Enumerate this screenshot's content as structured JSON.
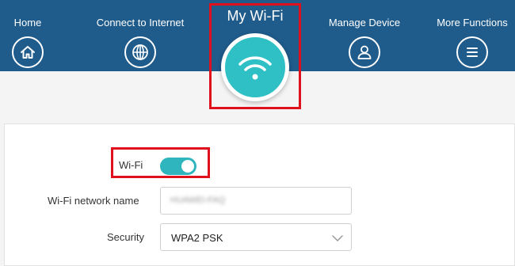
{
  "nav": {
    "items": [
      {
        "label": "Home",
        "icon": "home-icon"
      },
      {
        "label": "Connect to Internet",
        "icon": "globe-icon"
      },
      {
        "label": "Manage Device",
        "icon": "user-icon"
      },
      {
        "label": "More Functions",
        "icon": "menu-icon"
      }
    ],
    "active": {
      "label": "My Wi-Fi",
      "icon": "wifi-icon"
    }
  },
  "wifi_settings": {
    "wifi_label": "Wi-Fi",
    "wifi_enabled": true,
    "network_name_label": "Wi-Fi network name",
    "network_name_value": "HUAWEI-FAQ",
    "security_label": "Security",
    "security_value": "WPA2 PSK"
  },
  "colors": {
    "nav_bar": "#1f5b8b",
    "accent": "#2fc0c6",
    "highlight": "#e0101c"
  }
}
